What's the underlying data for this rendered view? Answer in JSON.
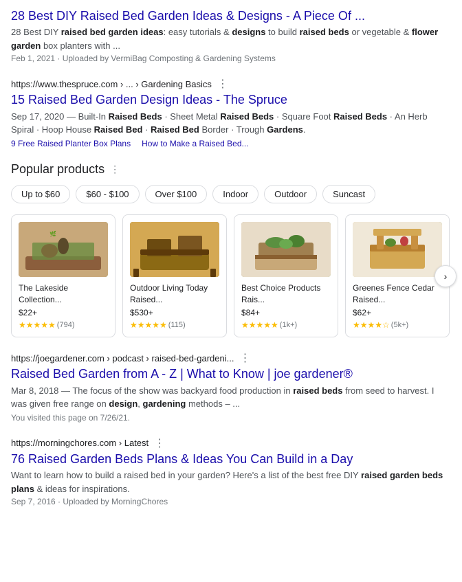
{
  "results": [
    {
      "id": "result1",
      "title": "28 Best DIY Raised Bed Garden Ideas & Designs - A Piece Of ...",
      "url": null,
      "snippet_html": "28 Best DIY <b>raised bed garden ideas</b>: easy tutorials & <b>designs</b> to build <b>raised beds</b> or vegetable & <b>flower garden</b> box planters with ...",
      "date": "Feb 1, 2021 · Uploaded by VermiBag Composting & Gardening Systems"
    },
    {
      "id": "result2",
      "url_display": "https://www.thespruce.com › ... › Gardening Basics",
      "title": "15 Raised Bed Garden Design Ideas - The Spruce",
      "snippet_html": "Sep 17, 2020 — Built-In <b>Raised Beds</b> · Sheet Metal <b>Raised Beds</b> · Square Foot <b>Raised Beds</b> · An Herb Spiral · Hoop House <b>Raised Bed</b> · <b>Raised Bed</b> Border · Trough <b>Gardens</b>.",
      "links": [
        "9 Free Raised Planter Box Plans",
        "How to Make a Raised Bed..."
      ],
      "date": null
    }
  ],
  "popular_products": {
    "heading": "Popular products",
    "filters": [
      "Up to $60",
      "$60 - $100",
      "Over $100",
      "Indoor",
      "Outdoor",
      "Suncast"
    ],
    "items": [
      {
        "name": "The Lakeside Collection...",
        "price": "$22+",
        "stars": "★★★★★",
        "stars_half": false,
        "rating_count": "(794)",
        "img_class": "product-img-1"
      },
      {
        "name": "Outdoor Living Today Raised...",
        "price": "$530+",
        "stars": "★★★★★",
        "stars_half": false,
        "rating_count": "(115)",
        "img_class": "product-img-2"
      },
      {
        "name": "Best Choice Products Rais...",
        "price": "$84+",
        "stars": "★★★★★",
        "stars_half": false,
        "rating_count": "(1k+)",
        "img_class": "product-img-3"
      },
      {
        "name": "Greenes Fence Cedar Raised...",
        "price": "$62+",
        "stars": "★★★★☆",
        "stars_half": true,
        "rating_count": "(5k+)",
        "img_class": "product-img-4"
      }
    ]
  },
  "results2": [
    {
      "id": "result3",
      "url_display": "https://joegardener.com › podcast › raised-bed-gardeni...",
      "title": "Raised Bed Garden from A - Z | What to Know | joe gardener®",
      "snippet_html": "Mar 8, 2018 — The focus of the show was backyard food production in <b>raised beds</b> from seed to harvest. I was given free range on <b>design</b>, <b>gardening</b> methods – ...",
      "visited": "You visited this page on 7/26/21."
    },
    {
      "id": "result4",
      "url_display": "https://morningchores.com › Latest",
      "title": "76 Raised Garden Beds Plans & Ideas You Can Build in a Day",
      "snippet_html": "Want to learn how to build a raised bed in your garden? Here's a list of the best free DIY <b>raised garden beds plans</b> & ideas for inspirations.",
      "date": "Sep 7, 2016 · Uploaded by MorningChores"
    }
  ],
  "carousel_next_label": "›"
}
